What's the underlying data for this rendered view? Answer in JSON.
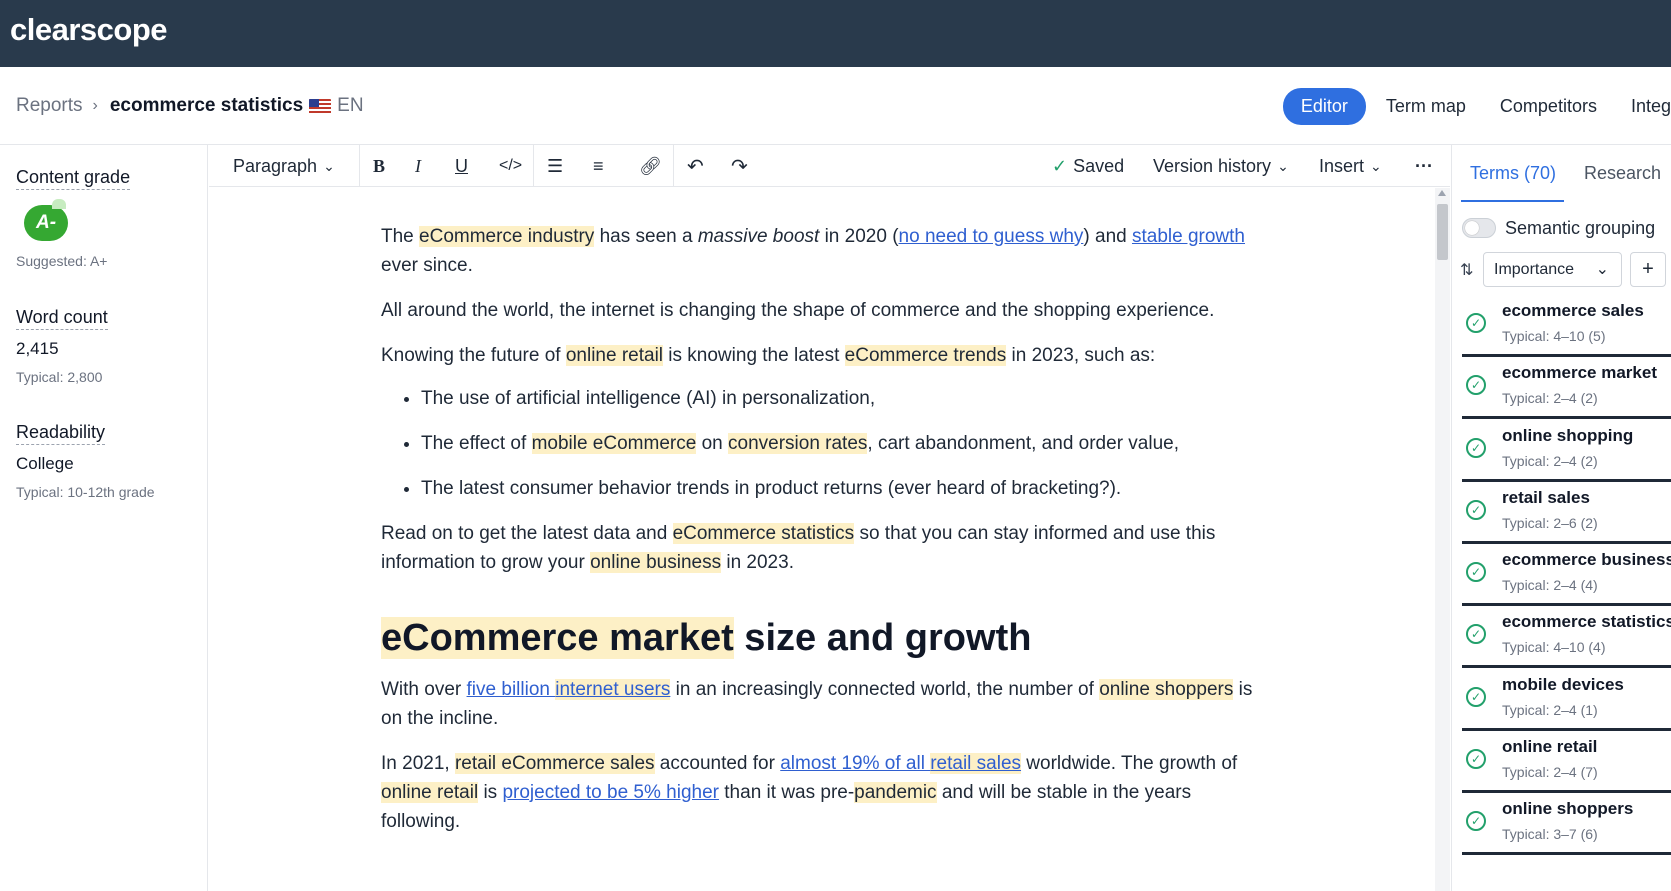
{
  "app": {
    "logo": "clearscope"
  },
  "breadcrumb": {
    "reports": "Reports",
    "title": "ecommerce statistics",
    "lang": "EN"
  },
  "nav_tabs": [
    "Editor",
    "Term map",
    "Competitors",
    "Integ"
  ],
  "sidebar": {
    "grade_label": "Content grade",
    "grade": "A-",
    "grade_suggested": "Suggested: A+",
    "word_count_label": "Word count",
    "word_count": "2,415",
    "word_count_typical": "Typical: 2,800",
    "readability_label": "Readability",
    "readability": "College",
    "readability_typical": "Typical: 10-12th grade"
  },
  "toolbar": {
    "paragraph": "Paragraph",
    "saved": "Saved",
    "version_history": "Version history",
    "insert": "Insert",
    "more": "···"
  },
  "doc": {
    "p1": [
      "The ",
      "eCommerce industry",
      " has seen a ",
      "massive boost",
      " in 2020 (",
      "no need to guess why",
      ") and ",
      "stable growth",
      " ever since."
    ],
    "p2": "All around the world, the internet is changing the shape of commerce and the shopping experience.",
    "p3": [
      "Knowing the future of ",
      "online retail",
      " is knowing the latest ",
      "eCommerce trends",
      " in 2023, such as:"
    ],
    "li1": "The use of artificial intelligence (AI) in personalization,",
    "li2": [
      "The effect of ",
      "mobile eCommerce",
      " on ",
      "conversion rates",
      ", cart abandonment, and order value,"
    ],
    "li3": "The latest consumer behavior trends in product returns (ever heard of bracketing?).",
    "p4": [
      "Read on to get the latest data and ",
      "eCommerce statistics",
      " so that you can stay informed and use this information to grow your ",
      "online business",
      " in 2023."
    ],
    "h2": [
      "eCommerce market",
      " size and growth"
    ],
    "p5": [
      "With over ",
      "five billion ",
      "internet users",
      " in an increasingly connected world, the number of ",
      "online shoppers",
      " is on the incline."
    ],
    "p6": [
      "In 2021, ",
      "retail eCommerce sales",
      " accounted for ",
      "almost 19% of all ",
      "retail sales",
      " worldwide. The growth of ",
      "online retail",
      " is ",
      "projected to be 5% higher",
      " than it was pre-",
      "pandemic",
      " and will be stable in the years following."
    ]
  },
  "right": {
    "tab_terms": "Terms (70)",
    "tab_research": "Research",
    "semantic": "Semantic grouping",
    "sort": "Importance",
    "plus": "+",
    "terms": [
      {
        "name": "ecommerce sales",
        "typical": "Typical: 4–10 (5)"
      },
      {
        "name": "ecommerce market",
        "typical": "Typical: 2–4 (2)"
      },
      {
        "name": "online shopping",
        "typical": "Typical: 2–4 (2)"
      },
      {
        "name": "retail sales",
        "typical": "Typical: 2–6 (2)"
      },
      {
        "name": "ecommerce business",
        "typical": "Typical: 2–4 (4)"
      },
      {
        "name": "ecommerce statistics",
        "typical": "Typical: 4–10 (4)"
      },
      {
        "name": "mobile devices",
        "typical": "Typical: 2–4 (1)"
      },
      {
        "name": "online retail",
        "typical": "Typical: 2–4 (7)"
      },
      {
        "name": "online shoppers",
        "typical": "Typical: 3–7 (6)"
      }
    ]
  },
  "colors": {
    "topbar": "#293a4c",
    "accent": "#2f6fe0",
    "highlight": "#fdf0c6",
    "link": "#2f5fd0",
    "grade": "#35a832",
    "check": "#22a06b"
  },
  "icons": [
    "bold-icon",
    "italic-icon",
    "underline-icon",
    "code-icon",
    "bullet-list-icon",
    "numbered-list-icon",
    "link-icon",
    "undo-icon",
    "redo-icon",
    "check-icon",
    "sort-icon",
    "chevron-down-icon"
  ]
}
